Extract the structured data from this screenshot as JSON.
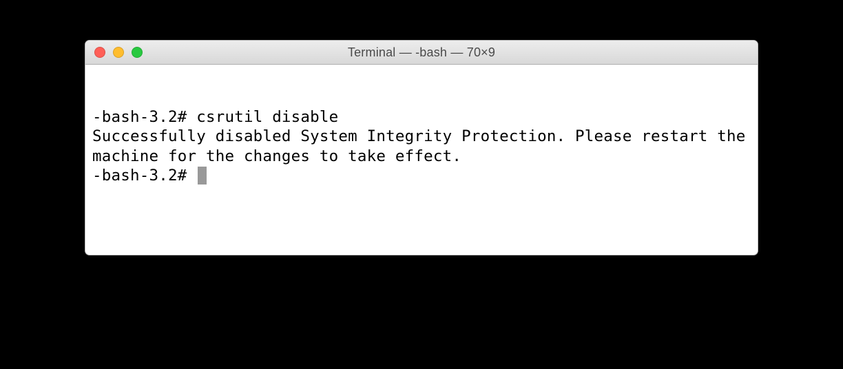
{
  "window": {
    "title": "Terminal — -bash — 70×9"
  },
  "terminal": {
    "line1_prompt": "-bash-3.2# ",
    "line1_command": "csrutil disable",
    "output": "Successfully disabled System Integrity Protection. Please restart the machine for the changes to take effect.",
    "line2_prompt": "-bash-3.2# "
  }
}
